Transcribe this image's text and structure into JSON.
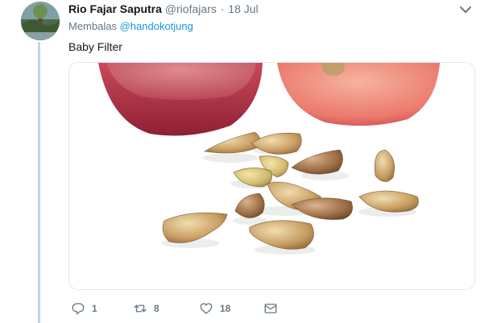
{
  "tweet": {
    "display_name": "Rio Fajar Saputra",
    "handle": "@riofajars",
    "separator": "·",
    "date": "18 Jul",
    "reply_prefix": "Membalas",
    "reply_to": "@handokotjung",
    "text": "Baby Filter",
    "media_icon": "grape-seeds-photo"
  },
  "actions": {
    "reply": {
      "icon": "reply-icon",
      "count": "1"
    },
    "retweet": {
      "icon": "retweet-icon",
      "count": "8"
    },
    "like": {
      "icon": "heart-icon",
      "count": "18"
    },
    "dm": {
      "icon": "mail-icon"
    }
  },
  "colors": {
    "link": "#1b95e0",
    "secondary_text": "#657786",
    "thread_line": "#bad8ec"
  }
}
